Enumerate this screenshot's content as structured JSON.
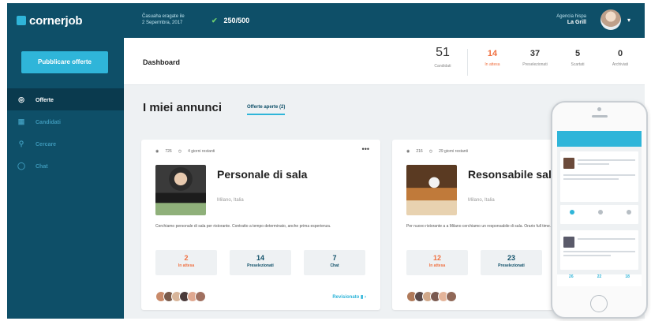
{
  "brand": {
    "name": "cornerjob",
    "accent": "#2fb5d9",
    "dark": "#0e4f68",
    "hot": "#f07040"
  },
  "topbar": {
    "period_line1": "Ĉasuaha eragate ile",
    "period_line2": "2 Sepermbra, 2017",
    "credits": "250/500",
    "user_line1": "Agencia hispa",
    "user_line2": "La Grill"
  },
  "sidebar": {
    "publish_label": "Pubblicare offerte",
    "items": [
      {
        "label": "Offerte",
        "icon": "target-icon"
      },
      {
        "label": "Candidati",
        "icon": "calendar-icon"
      },
      {
        "label": "Cercare",
        "icon": "search-icon"
      },
      {
        "label": "Chat",
        "icon": "chat-icon"
      }
    ]
  },
  "header": {
    "title": "Dashboard",
    "stats": [
      {
        "value": "51",
        "label": "Candidati"
      },
      {
        "value": "14",
        "label": "In attesa"
      },
      {
        "value": "37",
        "label": "Preselezionati"
      },
      {
        "value": "5",
        "label": "Scartati"
      },
      {
        "value": "0",
        "label": "Archiviati"
      }
    ]
  },
  "main": {
    "title": "I miei annunci",
    "tab": "Offerte aperte (2)"
  },
  "cards": [
    {
      "views": "726",
      "days": "4 giorni restanti",
      "title": "Personale di sala",
      "location": "Milano, Italia",
      "description": "Cerchiamo personale di sala per ristorante. Contratto a tempo determinato, anche prima esperienza.",
      "metrics": [
        {
          "value": "2",
          "label": "In attesa"
        },
        {
          "value": "14",
          "label": "Preselezionati"
        },
        {
          "value": "7",
          "label": "Chat"
        }
      ],
      "review": "Revisionato"
    },
    {
      "views": "216",
      "days": "29 giorni restanti",
      "title": "Resonsabile sala",
      "location": "Milano, Italia",
      "description": "Per nuovo ristorante a a Milano cerchiamo un responsabile di sala. Orario full time.",
      "metrics": [
        {
          "value": "12",
          "label": "In attesa"
        },
        {
          "value": "23",
          "label": "Preselezionati"
        },
        {
          "value": "",
          "label": ""
        }
      ],
      "review": ""
    }
  ],
  "phone": {
    "bars": [
      "26",
      "22",
      "18"
    ]
  }
}
